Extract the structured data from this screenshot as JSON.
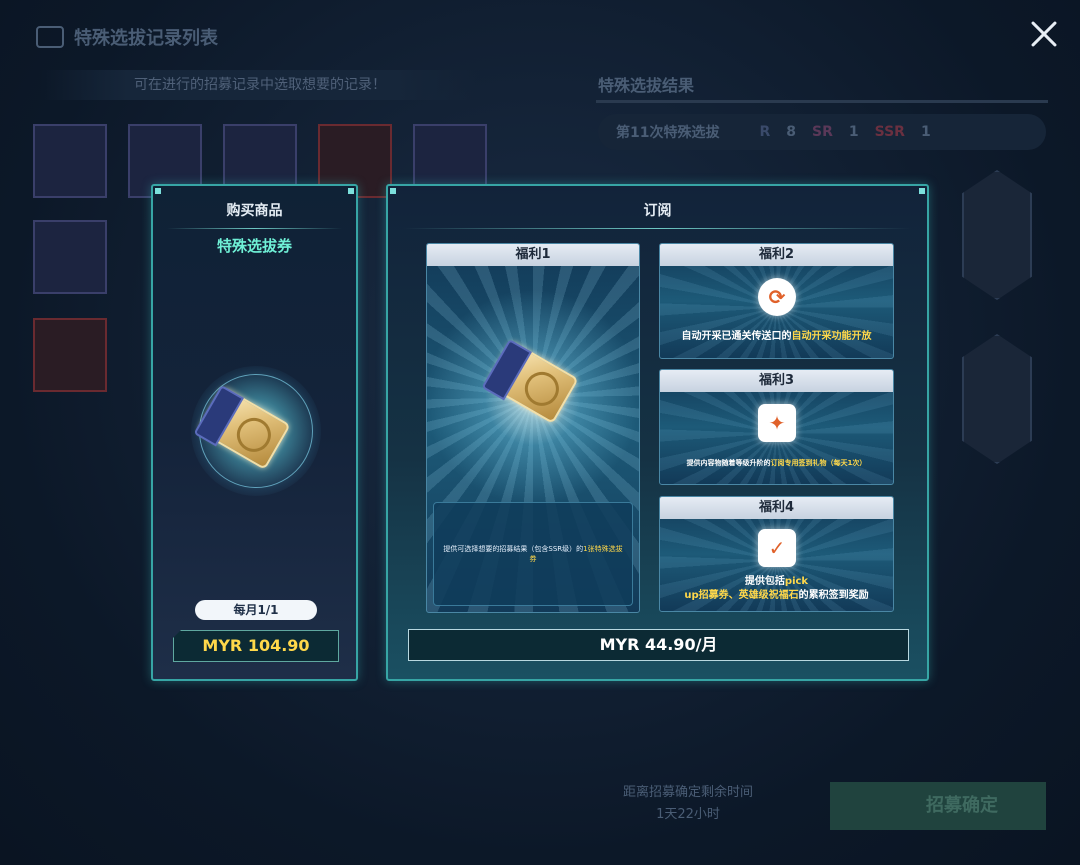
{
  "background": {
    "title": "特殊选拔记录列表",
    "subtitle": "可在进行的招募记录中选取想要的记录！",
    "result_title": "特殊选拔结果",
    "result_round": "第11次特殊选拔",
    "rank_r_label": "R",
    "rank_r_count": "8",
    "rank_sr_label": "SR",
    "rank_sr_count": "1",
    "rank_ssr_label": "SSR",
    "rank_ssr_count": "1",
    "timer_label": "距离招募确定剩余时间",
    "timer_value": "1天22小时",
    "recruit_button": "招募确定"
  },
  "purchase": {
    "header": "购买商品",
    "item_name": "特殊选拔券",
    "limit": "每月1/1",
    "price": "MYR 104.90"
  },
  "subscription": {
    "header": "订阅",
    "price": "MYR 44.90/月",
    "benefit1": {
      "title": "福利1",
      "desc_prefix": "提供可选择想要的招募结果（包含SSR级）的",
      "desc_highlight": "1张特殊选拔券"
    },
    "benefit2": {
      "title": "福利2",
      "desc_prefix": "自动开采已通关传送口的",
      "desc_highlight": "自动开采功能开放"
    },
    "benefit3": {
      "title": "福利3",
      "desc_prefix": "提供内容物随着等级升阶的",
      "desc_highlight": "订阅专用签到礼物（每天1次）"
    },
    "benefit4": {
      "title": "福利4",
      "desc_line1": "提供包括",
      "desc_line1_highlight": "pick",
      "desc_line2_highlight": "up招募券、英雄级祝福石",
      "desc_line2_suffix": "的累积签到奖励"
    }
  },
  "icons": {
    "close": "close-icon",
    "auto_mining": "auto-mining-icon",
    "gift": "gift-icon",
    "calendar": "calendar-check-icon",
    "ticket": "selection-ticket-icon"
  },
  "colors": {
    "accent_teal": "#37a5a5",
    "price_gold": "#ffd84a",
    "item_name_green": "#6ff0d6",
    "icon_orange": "#e0612a"
  }
}
